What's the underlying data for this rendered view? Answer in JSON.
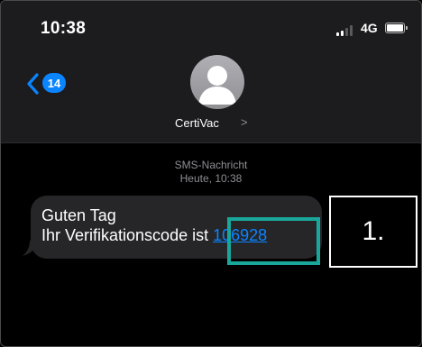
{
  "status_bar": {
    "time": "10:38",
    "network": "4G"
  },
  "nav": {
    "back_badge": "14",
    "contact_name": "CertiVac",
    "contact_chevron": ">"
  },
  "conversation": {
    "service_label": "SMS-Nachricht",
    "timestamp": "Heute, 10:38",
    "message": {
      "line1": "Guten Tag",
      "line2_prefix": "Ihr Verifikationscode ist ",
      "code": "106928"
    }
  },
  "annotation": {
    "step_label": "1."
  },
  "colors": {
    "accent": "#0a84ff",
    "highlight": "#1aa79b",
    "bubble": "#262629",
    "header": "#1c1c1e"
  },
  "icons": [
    "chevron-left-icon",
    "avatar-placeholder-icon",
    "signal-icon",
    "battery-icon"
  ]
}
